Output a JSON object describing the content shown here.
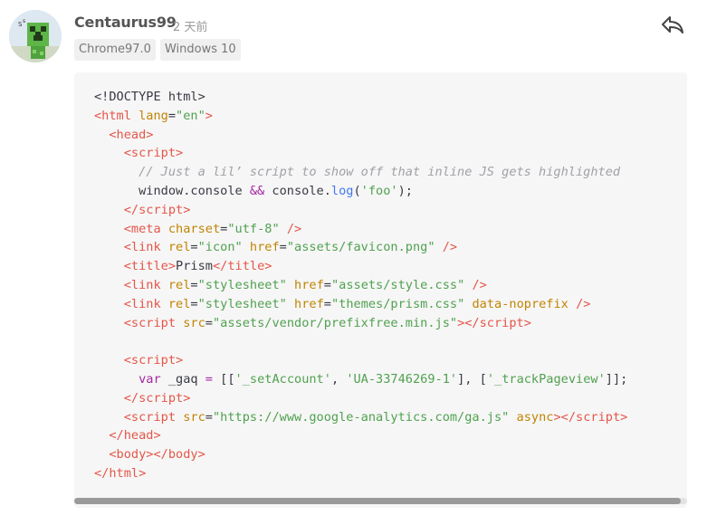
{
  "comment": {
    "author": "Centaurus99",
    "time": "2 天前",
    "tags": [
      "Chrome97.0",
      "Windows 10"
    ],
    "reply_icon": "reply-arrow-icon",
    "avatar_icon": "creeper-avatar-icon"
  },
  "code": {
    "language": "html",
    "lines": [
      [
        {
          "t": "punct",
          "v": "<!DOCTYPE html>"
        }
      ],
      [
        {
          "t": "tag",
          "v": "<html"
        },
        {
          "t": "plain",
          "v": " "
        },
        {
          "t": "attr",
          "v": "lang"
        },
        {
          "t": "punct",
          "v": "="
        },
        {
          "t": "str",
          "v": "\"en\""
        },
        {
          "t": "tag",
          "v": ">"
        }
      ],
      [
        {
          "t": "plain",
          "v": "  "
        },
        {
          "t": "tag",
          "v": "<head"
        },
        {
          "t": "tag",
          "v": ">"
        }
      ],
      [
        {
          "t": "plain",
          "v": "    "
        },
        {
          "t": "tag",
          "v": "<script"
        },
        {
          "t": "tag",
          "v": ">"
        }
      ],
      [
        {
          "t": "plain",
          "v": "      "
        },
        {
          "t": "comment",
          "v": "// Just a lil’ script to show off that inline JS gets highlighted"
        }
      ],
      [
        {
          "t": "plain",
          "v": "      window.console "
        },
        {
          "t": "op",
          "v": "&&"
        },
        {
          "t": "plain",
          "v": " console."
        },
        {
          "t": "fn",
          "v": "log"
        },
        {
          "t": "punct",
          "v": "("
        },
        {
          "t": "str",
          "v": "'foo'"
        },
        {
          "t": "punct",
          "v": ");"
        }
      ],
      [
        {
          "t": "plain",
          "v": "    "
        },
        {
          "t": "tag",
          "v": "</script"
        },
        {
          "t": "tag",
          "v": ">"
        }
      ],
      [
        {
          "t": "plain",
          "v": "    "
        },
        {
          "t": "tag",
          "v": "<meta"
        },
        {
          "t": "plain",
          "v": " "
        },
        {
          "t": "attr",
          "v": "charset"
        },
        {
          "t": "punct",
          "v": "="
        },
        {
          "t": "str",
          "v": "\"utf-8\""
        },
        {
          "t": "plain",
          "v": " "
        },
        {
          "t": "tag",
          "v": "/>"
        }
      ],
      [
        {
          "t": "plain",
          "v": "    "
        },
        {
          "t": "tag",
          "v": "<link"
        },
        {
          "t": "plain",
          "v": " "
        },
        {
          "t": "attr",
          "v": "rel"
        },
        {
          "t": "punct",
          "v": "="
        },
        {
          "t": "str",
          "v": "\"icon\""
        },
        {
          "t": "plain",
          "v": " "
        },
        {
          "t": "attr",
          "v": "href"
        },
        {
          "t": "punct",
          "v": "="
        },
        {
          "t": "str",
          "v": "\"assets/favicon.png\""
        },
        {
          "t": "plain",
          "v": " "
        },
        {
          "t": "tag",
          "v": "/>"
        }
      ],
      [
        {
          "t": "plain",
          "v": "    "
        },
        {
          "t": "tag",
          "v": "<title"
        },
        {
          "t": "tag",
          "v": ">"
        },
        {
          "t": "plain",
          "v": "Prism"
        },
        {
          "t": "tag",
          "v": "</title"
        },
        {
          "t": "tag",
          "v": ">"
        }
      ],
      [
        {
          "t": "plain",
          "v": "    "
        },
        {
          "t": "tag",
          "v": "<link"
        },
        {
          "t": "plain",
          "v": " "
        },
        {
          "t": "attr",
          "v": "rel"
        },
        {
          "t": "punct",
          "v": "="
        },
        {
          "t": "str",
          "v": "\"stylesheet\""
        },
        {
          "t": "plain",
          "v": " "
        },
        {
          "t": "attr",
          "v": "href"
        },
        {
          "t": "punct",
          "v": "="
        },
        {
          "t": "str",
          "v": "\"assets/style.css\""
        },
        {
          "t": "plain",
          "v": " "
        },
        {
          "t": "tag",
          "v": "/>"
        }
      ],
      [
        {
          "t": "plain",
          "v": "    "
        },
        {
          "t": "tag",
          "v": "<link"
        },
        {
          "t": "plain",
          "v": " "
        },
        {
          "t": "attr",
          "v": "rel"
        },
        {
          "t": "punct",
          "v": "="
        },
        {
          "t": "str",
          "v": "\"stylesheet\""
        },
        {
          "t": "plain",
          "v": " "
        },
        {
          "t": "attr",
          "v": "href"
        },
        {
          "t": "punct",
          "v": "="
        },
        {
          "t": "str",
          "v": "\"themes/prism.css\""
        },
        {
          "t": "plain",
          "v": " "
        },
        {
          "t": "attr",
          "v": "data-noprefix"
        },
        {
          "t": "plain",
          "v": " "
        },
        {
          "t": "tag",
          "v": "/>"
        }
      ],
      [
        {
          "t": "plain",
          "v": "    "
        },
        {
          "t": "tag",
          "v": "<script"
        },
        {
          "t": "plain",
          "v": " "
        },
        {
          "t": "attr",
          "v": "src"
        },
        {
          "t": "punct",
          "v": "="
        },
        {
          "t": "str",
          "v": "\"assets/vendor/prefixfree.min.js\""
        },
        {
          "t": "tag",
          "v": ">"
        },
        {
          "t": "tag",
          "v": "</script"
        },
        {
          "t": "tag",
          "v": ">"
        }
      ],
      [
        {
          "t": "plain",
          "v": ""
        }
      ],
      [
        {
          "t": "plain",
          "v": "    "
        },
        {
          "t": "tag",
          "v": "<script"
        },
        {
          "t": "tag",
          "v": ">"
        }
      ],
      [
        {
          "t": "plain",
          "v": "      "
        },
        {
          "t": "kw",
          "v": "var"
        },
        {
          "t": "plain",
          "v": " _gaq "
        },
        {
          "t": "op",
          "v": "="
        },
        {
          "t": "plain",
          "v": " "
        },
        {
          "t": "punct",
          "v": "[["
        },
        {
          "t": "str",
          "v": "'_setAccount'"
        },
        {
          "t": "punct",
          "v": ", "
        },
        {
          "t": "str",
          "v": "'UA-33746269-1'"
        },
        {
          "t": "punct",
          "v": "], ["
        },
        {
          "t": "str",
          "v": "'_trackPageview'"
        },
        {
          "t": "punct",
          "v": "]];"
        }
      ],
      [
        {
          "t": "plain",
          "v": "    "
        },
        {
          "t": "tag",
          "v": "</script"
        },
        {
          "t": "tag",
          "v": ">"
        }
      ],
      [
        {
          "t": "plain",
          "v": "    "
        },
        {
          "t": "tag",
          "v": "<script"
        },
        {
          "t": "plain",
          "v": " "
        },
        {
          "t": "attr",
          "v": "src"
        },
        {
          "t": "punct",
          "v": "="
        },
        {
          "t": "str",
          "v": "\"https://www.google-analytics.com/ga.js\""
        },
        {
          "t": "plain",
          "v": " "
        },
        {
          "t": "attr",
          "v": "async"
        },
        {
          "t": "tag",
          "v": ">"
        },
        {
          "t": "tag",
          "v": "</script"
        },
        {
          "t": "tag",
          "v": ">"
        }
      ],
      [
        {
          "t": "plain",
          "v": "  "
        },
        {
          "t": "tag",
          "v": "</head"
        },
        {
          "t": "tag",
          "v": ">"
        }
      ],
      [
        {
          "t": "plain",
          "v": "  "
        },
        {
          "t": "tag",
          "v": "<body"
        },
        {
          "t": "tag",
          "v": ">"
        },
        {
          "t": "tag",
          "v": "</body"
        },
        {
          "t": "tag",
          "v": ">"
        }
      ],
      [
        {
          "t": "tag",
          "v": "</html"
        },
        {
          "t": "tag",
          "v": ">"
        }
      ]
    ]
  },
  "colors": {
    "tag": "#e45649",
    "attr": "#c18401",
    "string": "#50a14f",
    "comment": "#a0a1a7",
    "keyword": "#a626a4",
    "function": "#4078f2",
    "code_background": "#f6f6f6"
  },
  "scrollbar": {
    "horizontal_scroll_fraction": 0.99
  }
}
